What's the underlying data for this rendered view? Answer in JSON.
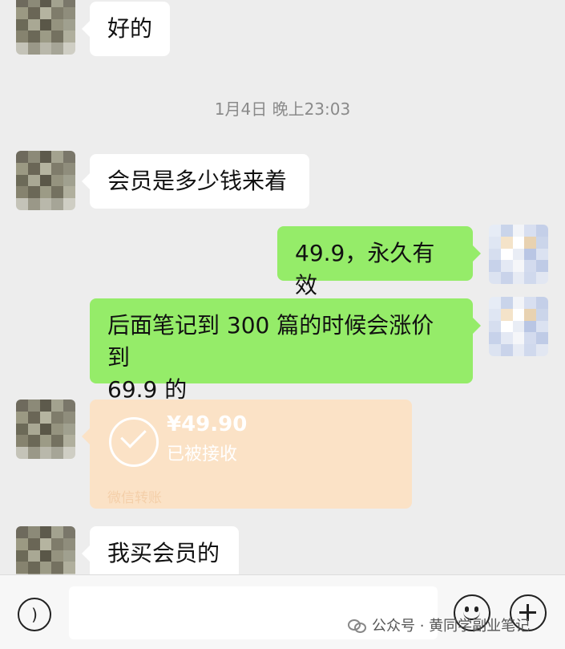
{
  "messages": [
    {
      "side": "left",
      "text": "好的"
    },
    {
      "type": "time",
      "text": "1月4日 晚上23:03"
    },
    {
      "side": "left",
      "text": "会员是多少钱来着"
    },
    {
      "side": "right",
      "text": "49.9，永久有效"
    },
    {
      "side": "right",
      "text_line1": "后面笔记到 300 篇的时候会涨价到",
      "text_line2": "69.9 的"
    },
    {
      "type": "transfer",
      "amount": "¥49.90",
      "status": "已被接收",
      "label": "微信转账"
    },
    {
      "side": "left",
      "text": "我买会员的"
    }
  ],
  "input_bar": {
    "voice_icon": "voice-icon",
    "emoji_icon": "emoji-icon",
    "plus_icon": "plus-icon"
  },
  "watermark": {
    "text": "公众号 · 黄同学副业笔记"
  },
  "colors": {
    "chat_background": "#ededed",
    "incoming_bubble": "#ffffff",
    "outgoing_bubble": "#95ec69",
    "transfer_card": "#fbe2c6"
  }
}
